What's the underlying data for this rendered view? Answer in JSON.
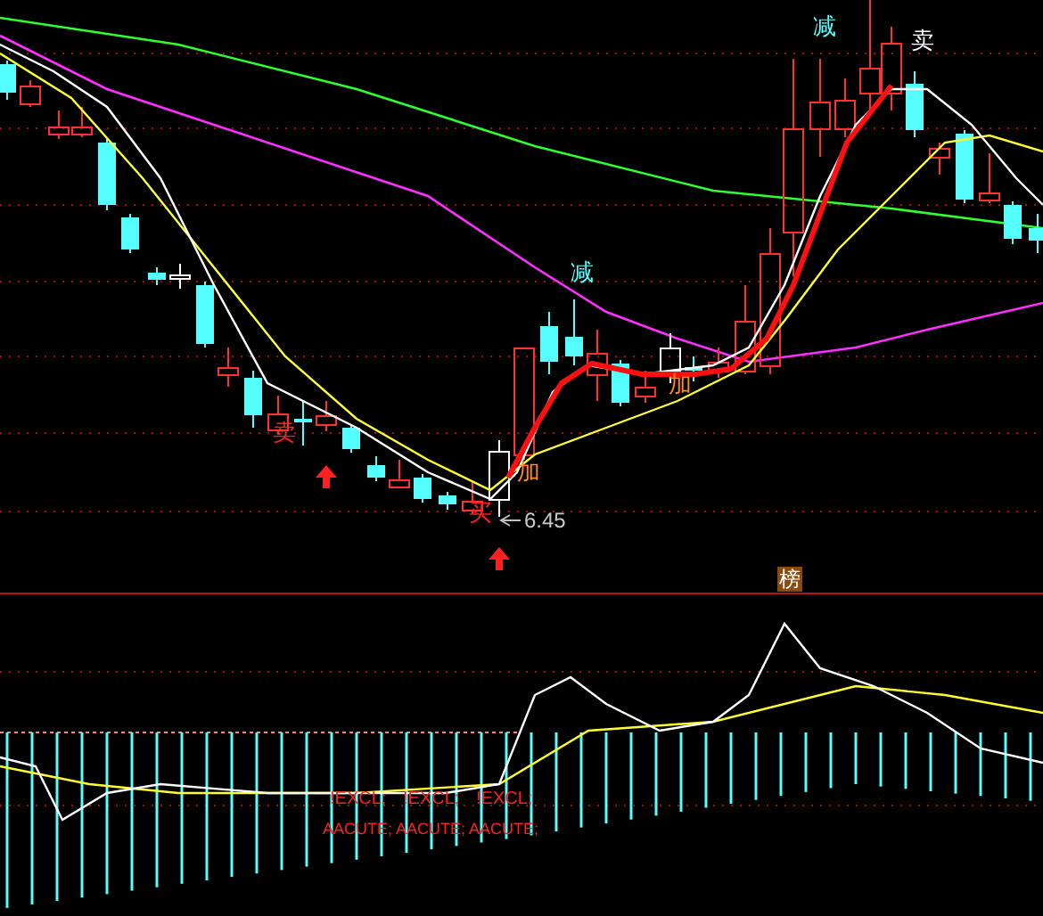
{
  "price_chart": {
    "markers": [
      {
        "text": "减",
        "color": "#55ffff"
      },
      {
        "text": "卖",
        "color": "#ffffff"
      },
      {
        "text": "减",
        "color": "#55ffff"
      },
      {
        "text": "加",
        "color": "#ff8c1a"
      },
      {
        "text": "卖",
        "color": "#ff2020"
      },
      {
        "text": "加",
        "color": "#ff8c1a"
      },
      {
        "text": "买",
        "color": "#ff2020"
      }
    ],
    "price_callout": "6.45",
    "badge": "榜"
  },
  "indicator_chart": {
    "labels_top": [
      "!EXCL;",
      "!EXCL;",
      "!EXCL;"
    ],
    "labels_bottom": [
      "AACUTE;",
      "AACUTE;",
      "AACUTE;"
    ]
  }
}
